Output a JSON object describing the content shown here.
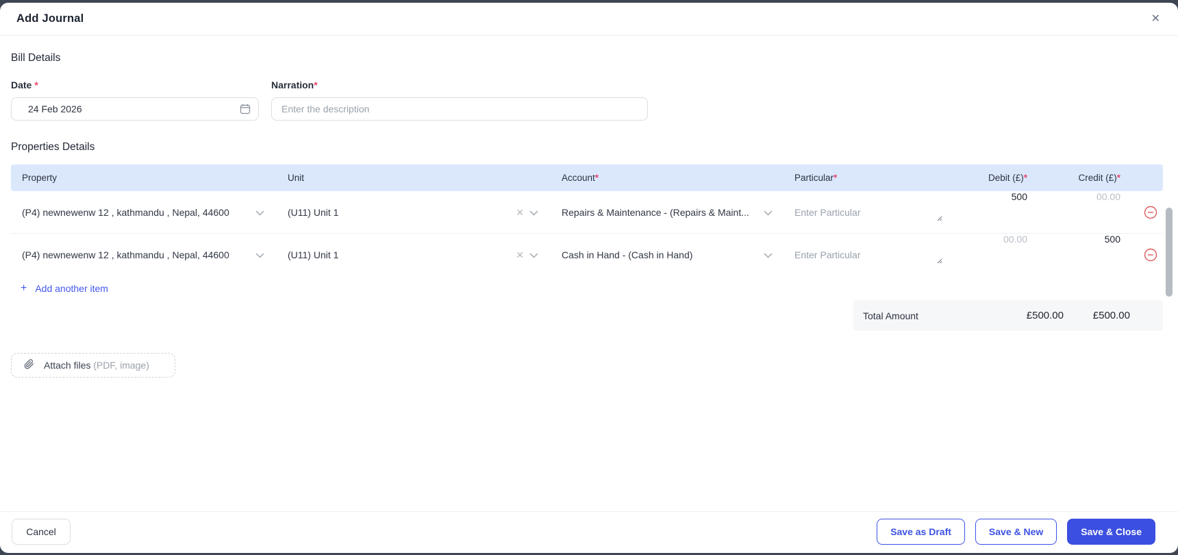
{
  "modal": {
    "title": "Add Journal",
    "close_icon": "✕"
  },
  "bill_details": {
    "heading": "Bill Details",
    "date": {
      "label": "Date",
      "required": "*",
      "value": "24 Feb 2026"
    },
    "narration": {
      "label": "Narration",
      "required": "*",
      "placeholder": "Enter the description"
    }
  },
  "properties": {
    "heading": "Properties Details",
    "columns": {
      "property": "Property",
      "unit": "Unit",
      "account": "Account",
      "particular": "Particular",
      "debit": "Debit (£)",
      "credit": "Credit (£)",
      "required": "*"
    },
    "rows": [
      {
        "property": "(P4) newnewenw 12 , kathmandu , Nepal, 44600",
        "unit": "(U11) Unit 1",
        "clear_icon": "✕",
        "account": "Repairs & Maintenance - (Repairs & Maint...",
        "particular_placeholder": "Enter Particular",
        "debit": "500",
        "credit_placeholder": "00.00"
      },
      {
        "property": "(P4) newnewenw 12 , kathmandu , Nepal, 44600",
        "unit": "(U11) Unit 1",
        "clear_icon": "✕",
        "account": "Cash in Hand - (Cash in Hand)",
        "particular_placeholder": "Enter Particular",
        "debit_placeholder": "00.00",
        "credit": "500"
      }
    ],
    "add_item": {
      "plus": "+",
      "label": "Add another item"
    },
    "total": {
      "label": "Total Amount",
      "debit": "£500.00",
      "credit": "£500.00"
    }
  },
  "attach": {
    "label": "Attach files",
    "hint": "(PDF, image)"
  },
  "footer": {
    "cancel": "Cancel",
    "save_draft": "Save as Draft",
    "save_new": "Save & New",
    "save_close": "Save & Close"
  },
  "colors": {
    "accent": "#3b4fe0",
    "link": "#4257ee",
    "table_header_bg": "#dbe8fc",
    "required_red": "#e8476f",
    "danger_icon": "#e05b5d",
    "backdrop": "#3e4553"
  }
}
